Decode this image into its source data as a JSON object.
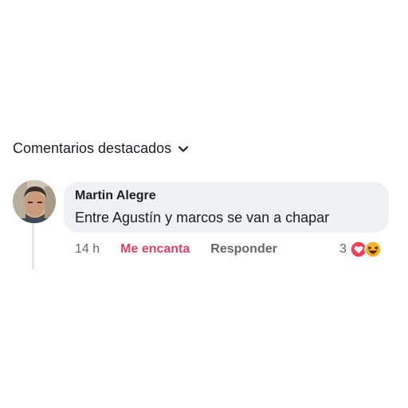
{
  "section": {
    "sort_label": "Comentarios destacados"
  },
  "comment": {
    "author": "Martin Alegre",
    "text": "Entre Agustín y marcos se van a chapar",
    "time": "14 h",
    "love_label": "Me encanta",
    "reply_label": "Responder",
    "reaction_count": "3",
    "reactions": [
      "love-reaction-icon",
      "haha-reaction-icon"
    ]
  },
  "colors": {
    "love_accent": "#e4405f",
    "bubble_bg": "#eff1f4",
    "secondary_text": "#65676b"
  }
}
